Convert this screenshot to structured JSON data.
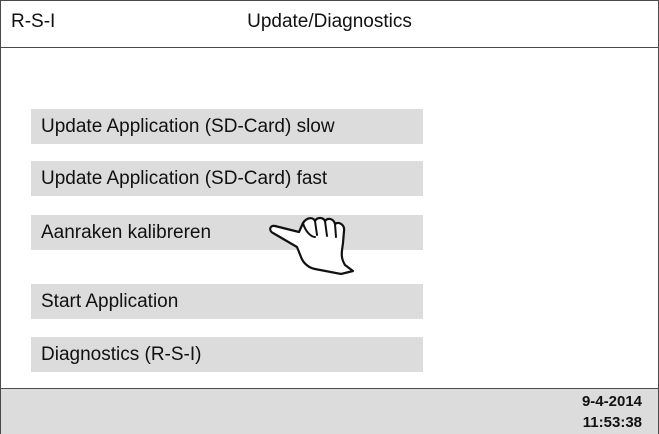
{
  "header": {
    "app_label": "R-S-I",
    "title": "Update/Diagnostics"
  },
  "menu": {
    "items": [
      {
        "label": "Update Application (SD-Card) slow"
      },
      {
        "label": "Update Application (SD-Card) fast"
      },
      {
        "label": "Aanraken kalibreren"
      },
      {
        "label": "Start Application"
      },
      {
        "label": "Diagnostics (R-S-I)"
      }
    ]
  },
  "status": {
    "date": "9-4-2014",
    "time": "11:53:38"
  },
  "icons": {
    "touch": "pointing-hand-icon"
  },
  "colors": {
    "button_bg": "#dcdcdc",
    "status_bg": "#dcdcdc",
    "border": "#4a4a4a"
  }
}
